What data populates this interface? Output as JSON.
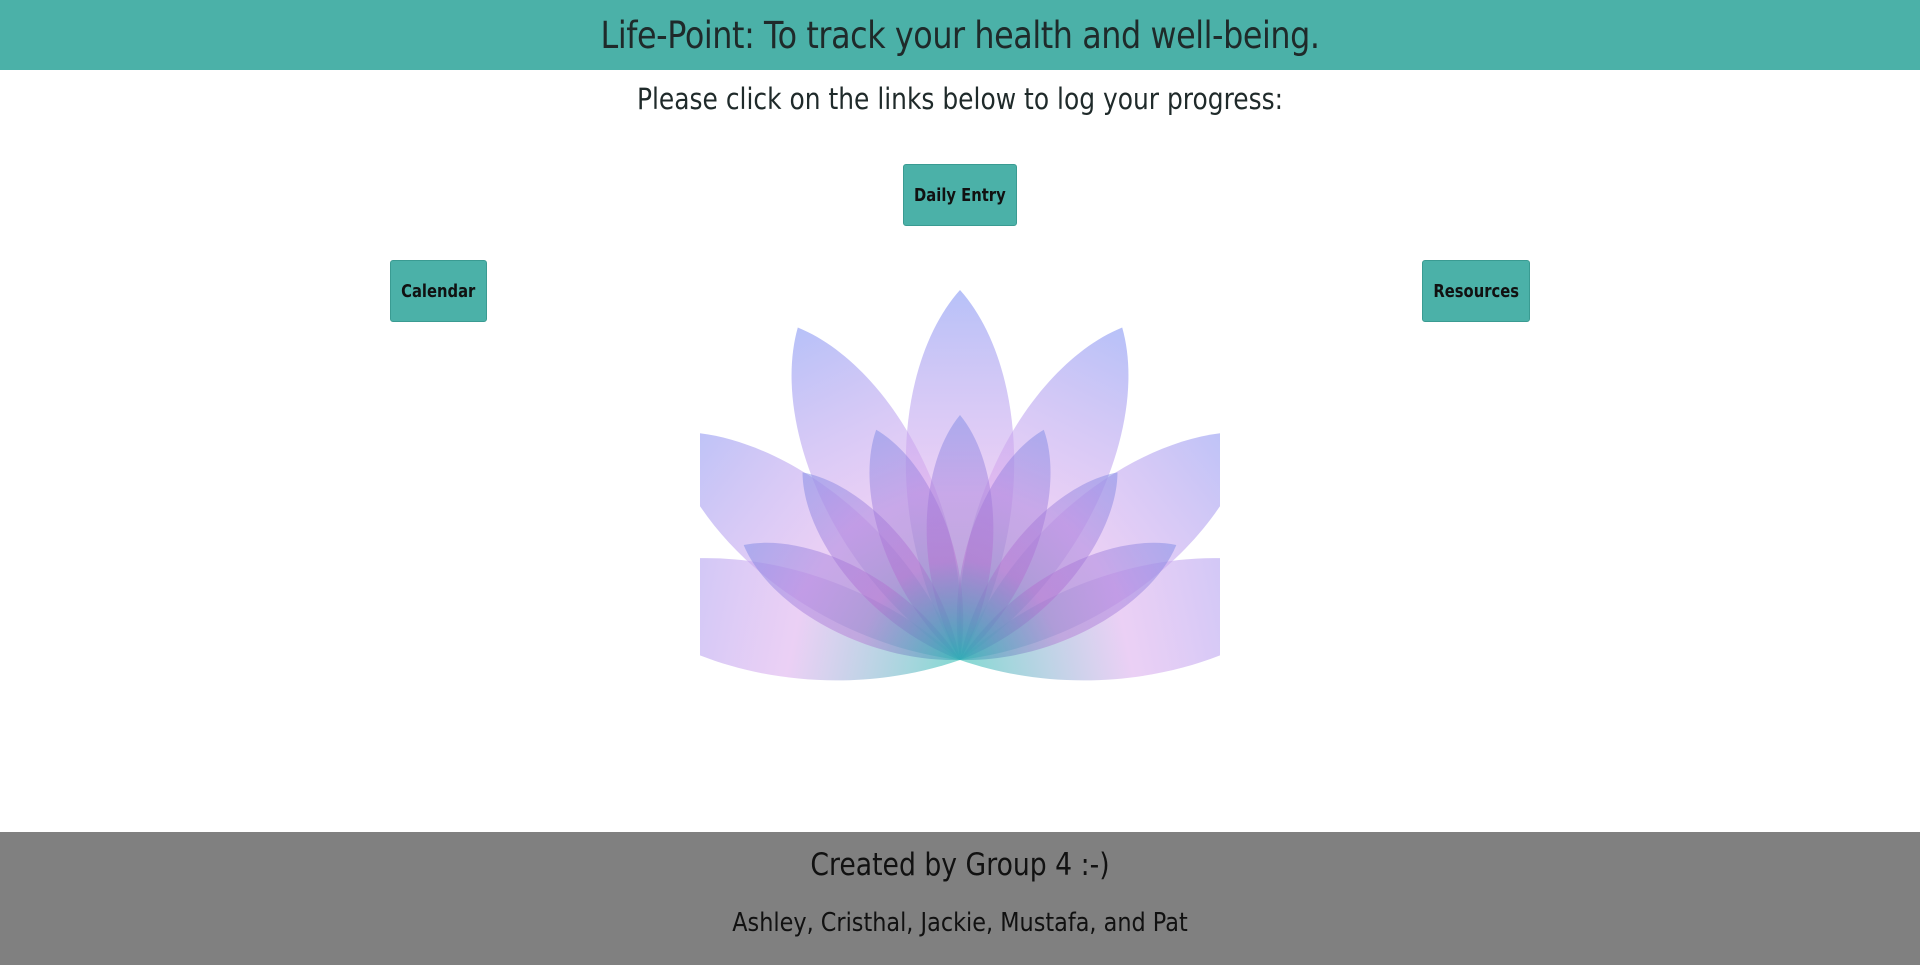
{
  "header": {
    "title": "Life-Point: To track your health and well-being."
  },
  "main": {
    "subtitle": "Please click on the links below to log your progress:",
    "links": {
      "daily_entry": "Daily Entry",
      "calendar": "Calendar",
      "resources": "Resources"
    },
    "image": {
      "icon": "lotus-flower",
      "colors": {
        "outer_petal": "#a3a6f3",
        "inner_petal": "#e3b6ef",
        "center": "#3ec3b8"
      }
    }
  },
  "footer": {
    "credit": "Created by Group 4 :-)",
    "names": "Ashley, Cristhal, Jackie, Mustafa, and Pat"
  },
  "colors": {
    "accent": "#4bb1a8",
    "footer_bg": "#808080"
  }
}
